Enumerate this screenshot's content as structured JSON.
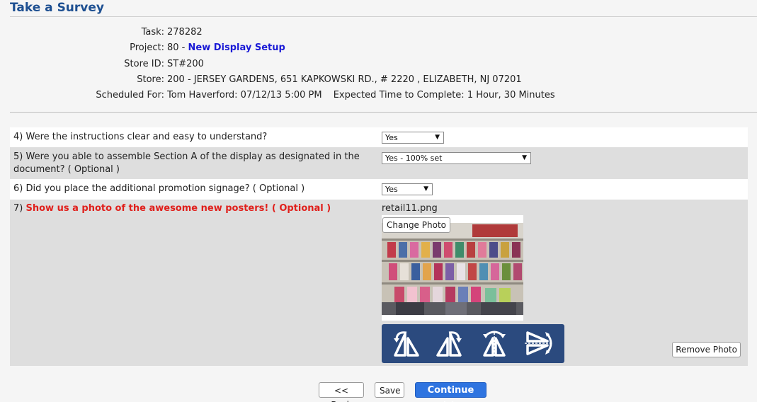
{
  "page": {
    "title": "Take a Survey"
  },
  "info": {
    "task_label": "Task:",
    "task_value": "278282",
    "project_label": "Project:",
    "project_prefix": "80 -",
    "project_link": "New Display Setup",
    "store_id_label": "Store ID:",
    "store_id_value": "ST#200",
    "store_label": "Store:",
    "store_value": "200 - JERSEY GARDENS, 651 KAPKOWSKI RD., # 2220 , ELIZABETH, NJ 07201",
    "scheduled_label": "Scheduled For:",
    "scheduled_value": "Tom Haverford: 07/12/13 5:00 PM",
    "expected_label": "Expected Time to Complete:",
    "expected_value": "1 Hour, 30 Minutes"
  },
  "questions": [
    {
      "text": "4) Were the instructions clear and easy to understand?",
      "selected": "Yes"
    },
    {
      "text": "5) Were you able to assemble Section A of the display as designated in the document? ( Optional )",
      "selected": "Yes - 100% set"
    },
    {
      "text": "6) Did you place the additional promotion signage? ( Optional )",
      "selected": "Yes"
    },
    {
      "number": "7)",
      "text": "Show us a photo of the awesome new posters! ( Optional )",
      "filename": "retail11.png",
      "change_photo_label": "Change Photo",
      "remove_photo_label": "Remove Photo"
    }
  ],
  "icons": {
    "select_arrow": "▼",
    "rotate_left": "rotate-left-icon",
    "rotate_right": "rotate-right-icon",
    "flip_vertical": "flip-vertical-icon",
    "flip_horizontal": "flip-horizontal-icon"
  },
  "nav": {
    "back_label": "<< Back",
    "save_label": "Save",
    "continue_label": "Continue >>"
  },
  "colors": {
    "title": "#1d4f91",
    "link": "#1a1ad6",
    "required_red": "#e0201c",
    "rotate_bar": "#2b4a7e",
    "continue_button": "#2e74e0"
  }
}
